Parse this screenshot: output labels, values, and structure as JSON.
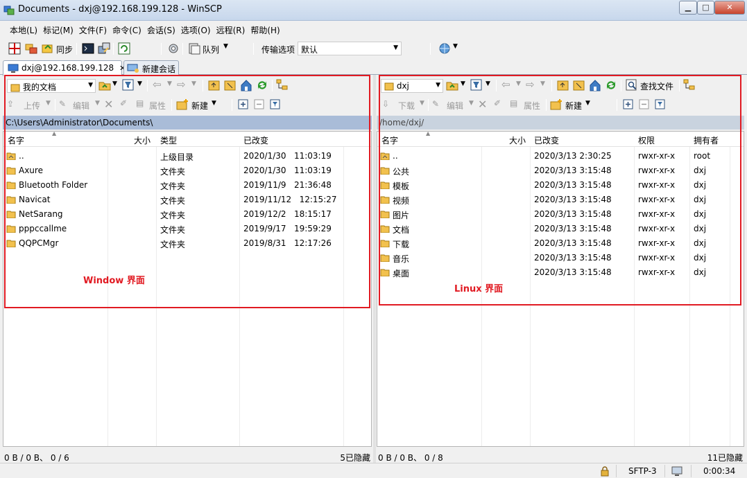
{
  "window": {
    "title": "Documents - dxj@192.168.199.128 - WinSCP",
    "min": "▁",
    "max": "□",
    "close": "✕"
  },
  "menu": [
    "本地(L)",
    "标记(M)",
    "文件(F)",
    "命令(C)",
    "会话(S)",
    "选项(O)",
    "远程(R)",
    "帮助(H)"
  ],
  "toolbar": {
    "sync_label": "同步",
    "queue_label": "队列",
    "transfer_label": "传输选项",
    "transfer_value": "默认"
  },
  "tabs": [
    {
      "label": "dxj@192.168.199.128",
      "close": "✕"
    },
    {
      "label": "新建会话"
    }
  ],
  "left": {
    "location": "我的文档",
    "upload_label": "上传",
    "edit_label": "编辑",
    "props_label": "属性",
    "new_label": "新建",
    "path": "C:\\Users\\Administrator\\Documents\\",
    "columns": [
      "名字",
      "大小",
      "类型",
      "已改变"
    ],
    "rows": [
      {
        "name": "..",
        "type": "上级目录",
        "date": "2020/1/30   11:03:19",
        "parent": true
      },
      {
        "name": "Axure",
        "type": "文件夹",
        "date": "2020/1/30   11:03:19"
      },
      {
        "name": "Bluetooth Folder",
        "type": "文件夹",
        "date": "2019/11/9   21:36:48"
      },
      {
        "name": "Navicat",
        "type": "文件夹",
        "date": "2019/11/12   12:15:27"
      },
      {
        "name": "NetSarang",
        "type": "文件夹",
        "date": "2019/12/2   18:15:17"
      },
      {
        "name": "pppccallme",
        "type": "文件夹",
        "date": "2019/9/17   19:59:29"
      },
      {
        "name": "QQPCMgr",
        "type": "文件夹",
        "date": "2019/8/31   12:17:26"
      }
    ],
    "annotation": "Window 界面",
    "status_left": "0 B / 0 B、 0 / 6",
    "status_right": "5已隐藏"
  },
  "right": {
    "location": "dxj",
    "find_label": "查找文件",
    "download_label": "下载",
    "edit_label": "编辑",
    "props_label": "属性",
    "new_label": "新建",
    "path": "/home/dxj/",
    "columns": [
      "名字",
      "大小",
      "已改变",
      "权限",
      "拥有者"
    ],
    "rows": [
      {
        "name": "..",
        "date": "2020/3/13 2:30:25",
        "perm": "rwxr-xr-x",
        "owner": "root",
        "parent": true
      },
      {
        "name": "公共",
        "date": "2020/3/13 3:15:48",
        "perm": "rwxr-xr-x",
        "owner": "dxj"
      },
      {
        "name": "模板",
        "date": "2020/3/13 3:15:48",
        "perm": "rwxr-xr-x",
        "owner": "dxj"
      },
      {
        "name": "视频",
        "date": "2020/3/13 3:15:48",
        "perm": "rwxr-xr-x",
        "owner": "dxj"
      },
      {
        "name": "图片",
        "date": "2020/3/13 3:15:48",
        "perm": "rwxr-xr-x",
        "owner": "dxj"
      },
      {
        "name": "文档",
        "date": "2020/3/13 3:15:48",
        "perm": "rwxr-xr-x",
        "owner": "dxj"
      },
      {
        "name": "下载",
        "date": "2020/3/13 3:15:48",
        "perm": "rwxr-xr-x",
        "owner": "dxj"
      },
      {
        "name": "音乐",
        "date": "2020/3/13 3:15:48",
        "perm": "rwxr-xr-x",
        "owner": "dxj"
      },
      {
        "name": "桌面",
        "date": "2020/3/13 3:15:48",
        "perm": "rwxr-xr-x",
        "owner": "dxj"
      }
    ],
    "annotation": "Linux 界面",
    "status_left": "0 B / 0 B、 0 / 8",
    "status_right": "11已隐藏"
  },
  "bottom": {
    "protocol": "SFTP-3",
    "elapsed": "0:00:34"
  }
}
